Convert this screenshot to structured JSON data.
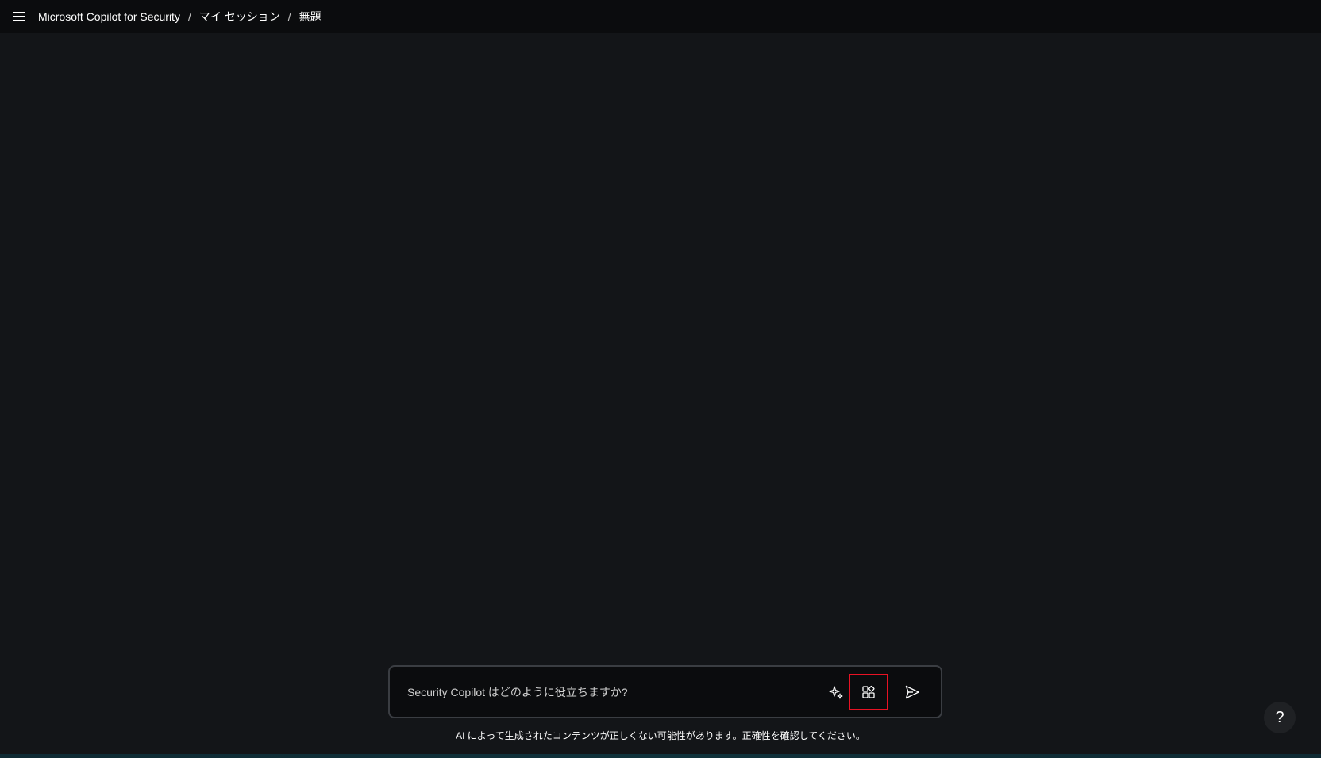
{
  "topbar": {
    "menu_icon": "hamburger-menu-icon",
    "breadcrumb": {
      "app": "Microsoft Copilot for Security",
      "separator": "/",
      "sessions": "マイ セッション",
      "current": "無題"
    }
  },
  "composer": {
    "placeholder": "Security Copilot はどのように役立ちますか?",
    "value": "",
    "sparkle_icon": "sparkle-icon",
    "prompts_icon": "prompts-grid-icon",
    "send_icon": "send-icon",
    "highlight_color": "#e81224"
  },
  "footer": {
    "disclaimer": "AI によって生成されたコンテンツが正しくない可能性があります。正確性を確認してください。"
  },
  "help": {
    "label": "?"
  },
  "colors": {
    "background": "#131518",
    "topbar": "#0b0c0e",
    "text": "#ffffff"
  }
}
